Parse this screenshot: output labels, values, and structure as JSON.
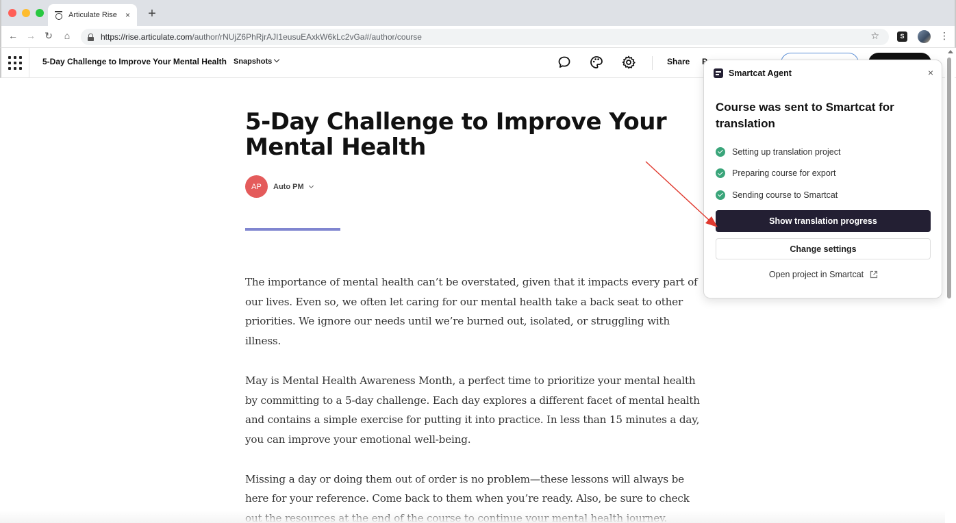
{
  "browser": {
    "tab_title": "Articulate Rise",
    "tab_close": "×",
    "new_tab": "+",
    "url_host": "https://rise.articulate.com",
    "url_path": "/author/rNUjZ6PhRjrAJI1eusuEAxkW6kLc2vGa#/author/course",
    "back": "←",
    "forward": "→",
    "reload": "↻",
    "home": "⌂",
    "bookmark": "☆",
    "menu": "⋮",
    "extension_label": "S"
  },
  "header": {
    "course_title": "5-Day Challenge to Improve Your Mental Health",
    "snapshots_label": "Snapshots",
    "share_label": "Share",
    "preview_label_partial": "P"
  },
  "course": {
    "title": "5-Day Challenge to Improve Your Mental Health",
    "author_initials": "AP",
    "author_name": "Auto PM",
    "accent_color": "#8086d0",
    "paragraphs": [
      "The importance of mental health can’t be overstated, given that it impacts every part of our lives. Even so, we often let caring for our mental health take a back seat to other priorities. We ignore our needs until we’re burned out, isolated, or struggling with illness.",
      "May is Mental Health Awareness Month, a perfect time to prioritize your mental health by committing to a 5-day challenge. Each day explores a different facet of mental health and contains a simple exercise for putting it into practice. In less than 15 minutes a day, you can improve your emotional well-being.",
      "Missing a day or doing them out of order is no problem—these lessons will always be here for your reference. Come back to them when you’re ready. Also, be sure to check out the resources at the end of the course to continue your mental health journey."
    ]
  },
  "smartcat_panel": {
    "title": "Smartcat Agent",
    "close": "×",
    "heading": "Course was sent to Smartcat for translation",
    "steps": [
      "Setting up translation project",
      "Preparing course for export",
      "Sending course to Smartcat"
    ],
    "primary_button": "Show translation progress",
    "secondary_button": "Change settings",
    "open_link": "Open project in Smartcat",
    "primary_color": "#231f33",
    "check_color": "#3aa57a"
  },
  "annotation": {
    "arrow_color": "#e03a2f"
  }
}
